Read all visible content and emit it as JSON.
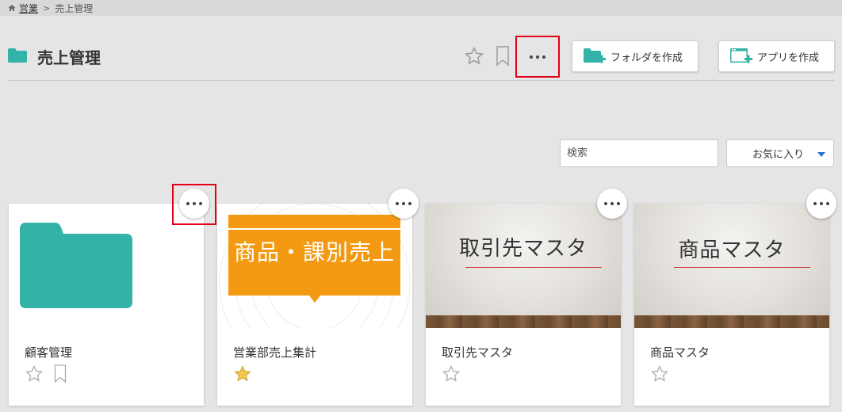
{
  "breadcrumb": {
    "home": "営業",
    "current": "売上管理"
  },
  "header": {
    "title": "売上管理",
    "create_folder_label": "フォルダを作成",
    "create_app_label": "アプリを作成"
  },
  "search": {
    "placeholder": "検索"
  },
  "filter": {
    "selected": "お気に入り"
  },
  "cards": [
    {
      "name": "顧客管理",
      "type": "folder",
      "favorited": false,
      "bookmark": true
    },
    {
      "name": "営業部売上集計",
      "type": "app",
      "thumb_title": "商品・課別売上",
      "favorited": true,
      "bookmark": false
    },
    {
      "name": "取引先マスタ",
      "type": "app",
      "thumb_title": "取引先マスタ",
      "favorited": false,
      "bookmark": false
    },
    {
      "name": "商品マスタ",
      "type": "app",
      "thumb_title": "商品マスタ",
      "favorited": false,
      "bookmark": false
    }
  ],
  "colors": {
    "folder": "#33b2a8",
    "orange_tile": "#f39a12",
    "favorite_star": "#f2c94c",
    "highlight_box": "#e2001a",
    "caret": "#2a74c9"
  }
}
